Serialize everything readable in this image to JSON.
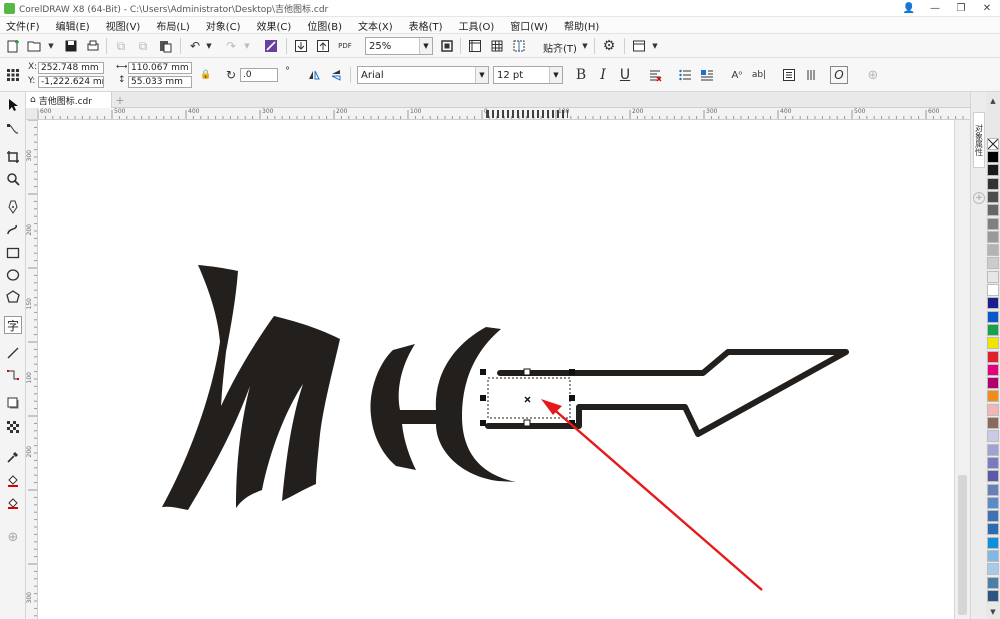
{
  "window": {
    "title": "CorelDRAW X8 (64-Bit) - C:\\Users\\Administrator\\Desktop\\吉他图标.cdr",
    "controls": [
      "👤",
      "—",
      "❐",
      "✕"
    ]
  },
  "menu": [
    "文件(F)",
    "编辑(E)",
    "视图(V)",
    "布局(L)",
    "对象(C)",
    "效果(C)",
    "位图(B)",
    "文本(X)",
    "表格(T)",
    "工具(O)",
    "窗口(W)",
    "帮助(H)"
  ],
  "standard_toolbar": {
    "zoom": "25%",
    "snap_label": "贴齐(T)",
    "pdf_label": "PDF"
  },
  "property_bar": {
    "x_label": "X:",
    "x_value": "252.748 mm",
    "y_label": "Y:",
    "y_value": "-1,222.624 mm",
    "width_value": "110.067 mm",
    "height_value": "55.033 mm",
    "rotation_value": ".0",
    "rotation_unit": "°",
    "font_name": "Arial",
    "font_size": "12 pt",
    "bold": "B",
    "italic": "I",
    "underline": "U"
  },
  "document_tab": {
    "label": "吉他图标.cdr",
    "add_label": "+"
  },
  "ruler": {
    "h_labels": [
      "600",
      "500",
      "400",
      "300",
      "200",
      "100",
      "0",
      "100",
      "200",
      "300",
      "400",
      "500",
      "600"
    ],
    "v_labels": [
      "300",
      "200",
      "150",
      "100",
      "200",
      "300"
    ]
  },
  "dock": {
    "tab_label": "对象属性"
  },
  "palette": {
    "colors": [
      "#000000",
      "#1a1a1a",
      "#333333",
      "#4d4d4d",
      "#666666",
      "#808080",
      "#999999",
      "#b3b3b3",
      "#cccccc",
      "#e6e6e6",
      "#ffffff",
      "#1b1f8c",
      "#0a58c9",
      "#18a04a",
      "#f2e600",
      "#e0202a",
      "#e4007f",
      "#b0006a",
      "#f28c18",
      "#f3b6b6",
      "#8a6a5a",
      "#c9c9e8",
      "#a1a1d4",
      "#7a7ac0",
      "#5a5aa8",
      "#6a7fb8",
      "#5b8bc7",
      "#3f72b5",
      "#2d6bb0",
      "#0f8fd8",
      "#7fb8e3",
      "#a6cbe8",
      "#4b7fa8",
      "#2b5580"
    ]
  },
  "colors": {
    "artwork": "#231f1c",
    "arrow": "#e51b1b"
  }
}
